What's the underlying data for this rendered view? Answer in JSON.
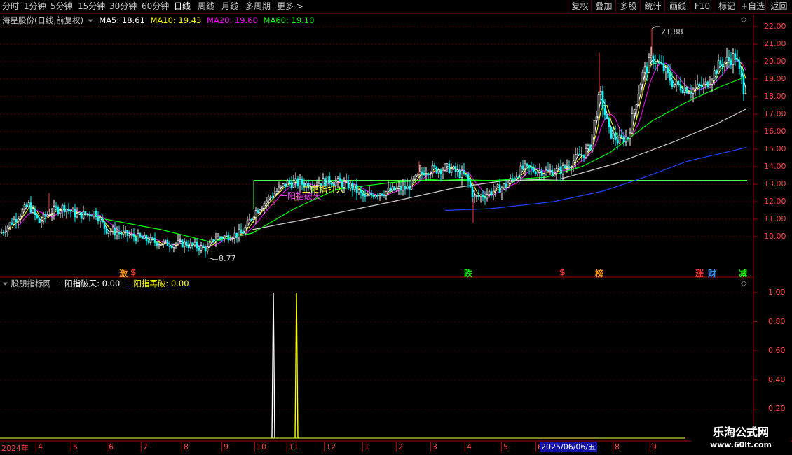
{
  "toolbar": {
    "periods": [
      "分时",
      "1分钟",
      "5分钟",
      "15分钟",
      "30分钟",
      "60分钟",
      "日线",
      "周线",
      "月线",
      "多周期",
      "更多"
    ],
    "active_index": 6,
    "right_buttons": [
      "复权",
      "叠加",
      "多股",
      "统计",
      "画线",
      "F10",
      "标记",
      "+自选",
      "返回"
    ]
  },
  "main_header": {
    "stock": "海星股份(日线,前复权)",
    "ma": [
      {
        "label": "MA5: 18.61",
        "color": "#ffffff"
      },
      {
        "label": "MA10: 19.43",
        "color": "#ffff00"
      },
      {
        "label": "MA20: 19.60",
        "color": "#ff00ff"
      },
      {
        "label": "MA60: 19.10",
        "color": "#00ff00"
      }
    ]
  },
  "price_axis": [
    "22.00",
    "21.00",
    "20.00",
    "19.00",
    "18.00",
    "17.00",
    "16.00",
    "15.00",
    "14.00",
    "13.00",
    "12.00",
    "11.00",
    "10.00"
  ],
  "price_annotations": {
    "high": "21.88",
    "low": "8.77"
  },
  "chart_labels": {
    "signal1": "一阳指破天",
    "signal2": "二阳指打入"
  },
  "event_markers": [
    {
      "text": "激",
      "color": "#ff9900"
    },
    {
      "text": "$",
      "color": "#ff3333"
    },
    {
      "text": "跌",
      "color": "#00ff00"
    },
    {
      "text": "$",
      "color": "#ff3333"
    },
    {
      "text": "榜",
      "color": "#ff9900"
    },
    {
      "text": "涨",
      "color": "#ff3333"
    },
    {
      "text": "财",
      "color": "#3399ff"
    },
    {
      "text": "减",
      "color": "#00ff00"
    }
  ],
  "indicator_header": {
    "name": "股朋指标网",
    "values": [
      {
        "label": "一阳指破天: 0.00",
        "color": "#ffffff"
      },
      {
        "label": "二阳指再破: 0.00",
        "color": "#ffff00"
      }
    ]
  },
  "indicator_axis": [
    "1.00",
    "0.80",
    "0.60",
    "0.40",
    "0.20"
  ],
  "time_axis": {
    "year": "2024年",
    "months": [
      "4",
      "5",
      "6",
      "7",
      "8",
      "9",
      "10",
      "11",
      "12",
      "1",
      "2",
      "3",
      "4",
      "5",
      "6",
      "7",
      "8",
      "9"
    ],
    "cursor_date": "2025/06/06/五"
  },
  "watermark": {
    "title": "乐淘公式网",
    "url": "www.60lt.com"
  },
  "chart_data": {
    "type": "candlestick",
    "ylim": [
      9,
      22.4
    ],
    "yticks": [
      22,
      21,
      20,
      19,
      18,
      17,
      16,
      15,
      14,
      13,
      12,
      11,
      10
    ],
    "high": 21.88,
    "low": 8.77,
    "keypoints": [
      [
        0,
        10.2
      ],
      [
        25,
        11.2
      ],
      [
        40,
        11.8
      ],
      [
        55,
        10.8
      ],
      [
        70,
        11.4
      ],
      [
        90,
        11.7
      ],
      [
        110,
        11.2
      ],
      [
        135,
        11.4
      ],
      [
        150,
        10.4
      ],
      [
        190,
        10.0
      ],
      [
        230,
        9.6
      ],
      [
        260,
        9.6
      ],
      [
        295,
        9.3
      ],
      [
        305,
        9.9
      ],
      [
        345,
        10.2
      ],
      [
        362,
        11.4
      ],
      [
        385,
        12.3
      ],
      [
        410,
        13.1
      ],
      [
        440,
        13.0
      ],
      [
        470,
        13.2
      ],
      [
        500,
        12.9
      ],
      [
        520,
        12.2
      ],
      [
        535,
        12.5
      ],
      [
        555,
        12.6
      ],
      [
        580,
        12.8
      ],
      [
        605,
        13.8
      ],
      [
        640,
        13.9
      ],
      [
        665,
        13.4
      ],
      [
        675,
        12.2
      ],
      [
        690,
        12.4
      ],
      [
        720,
        12.9
      ],
      [
        745,
        13.9
      ],
      [
        780,
        13.7
      ],
      [
        800,
        13.8
      ],
      [
        825,
        14.6
      ],
      [
        840,
        15.0
      ],
      [
        855,
        18.2
      ],
      [
        868,
        16.0
      ],
      [
        880,
        15.5
      ],
      [
        895,
        15.7
      ],
      [
        915,
        19.2
      ],
      [
        930,
        20.2
      ],
      [
        945,
        19.6
      ],
      [
        960,
        18.7
      ],
      [
        985,
        18.4
      ],
      [
        1005,
        18.6
      ],
      [
        1025,
        19.8
      ],
      [
        1048,
        20.3
      ],
      [
        1060,
        18.5
      ]
    ],
    "ma_lines": [
      {
        "color": "#00ff00",
        "points": [
          [
            150,
            11.0
          ],
          [
            230,
            10.4
          ],
          [
            300,
            9.7
          ],
          [
            360,
            10.2
          ],
          [
            420,
            11.6
          ],
          [
            480,
            12.7
          ],
          [
            560,
            13.1
          ],
          [
            630,
            13.3
          ],
          [
            700,
            13.2
          ],
          [
            780,
            13.4
          ],
          [
            830,
            14.0
          ],
          [
            870,
            14.8
          ],
          [
            930,
            16.6
          ],
          [
            980,
            17.7
          ],
          [
            1030,
            18.6
          ],
          [
            1062,
            19.1
          ]
        ]
      },
      {
        "color": "#d0d0d0",
        "points": [
          [
            360,
            10.4
          ],
          [
            450,
            11.1
          ],
          [
            560,
            12.0
          ],
          [
            650,
            12.8
          ],
          [
            720,
            13.2
          ],
          [
            800,
            13.3
          ],
          [
            880,
            14.2
          ],
          [
            960,
            15.4
          ],
          [
            1020,
            16.4
          ],
          [
            1065,
            17.3
          ]
        ]
      },
      {
        "color": "#2040ff",
        "points": [
          [
            635,
            11.5
          ],
          [
            700,
            11.6
          ],
          [
            790,
            12.0
          ],
          [
            860,
            12.6
          ],
          [
            920,
            13.4
          ],
          [
            980,
            14.3
          ],
          [
            1065,
            15.1
          ]
        ]
      }
    ],
    "support_line": 13.2,
    "indicator": {
      "ylim": [
        0,
        1.1
      ],
      "spikes": [
        {
          "x": 390,
          "color": "#ffffff"
        },
        {
          "x": 423,
          "color": "#ffff00"
        }
      ]
    }
  }
}
